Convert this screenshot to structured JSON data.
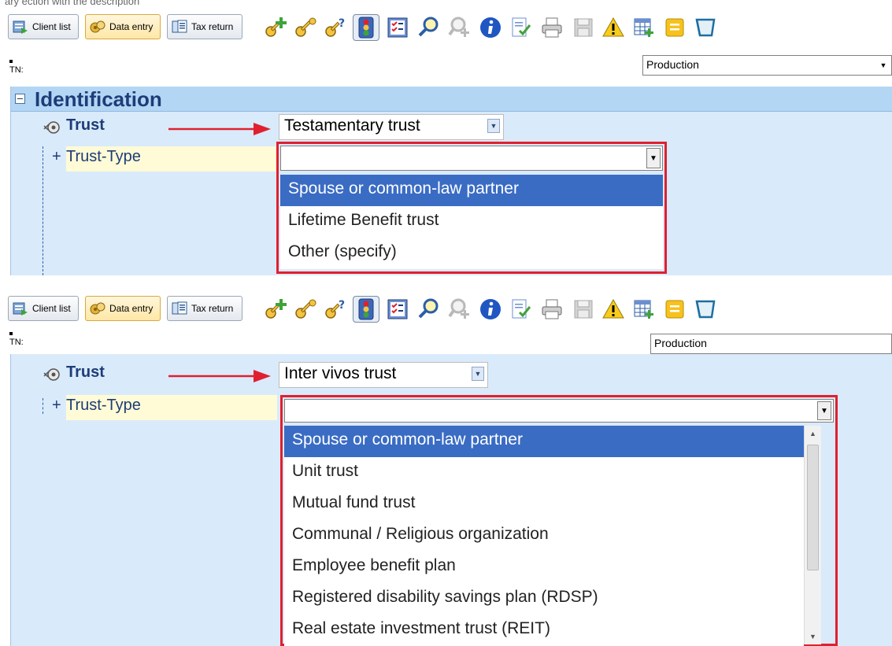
{
  "top_panel": {
    "top_cut_text": "ary                        ection  with  the  description",
    "toolbar": {
      "tabs": [
        {
          "name": "client-list-tab",
          "label": "Client list",
          "icon": "client-list-icon"
        },
        {
          "name": "data-entry-tab",
          "label": "Data entry",
          "icon": "data-entry-icon"
        },
        {
          "name": "tax-return-tab",
          "label": "Tax return",
          "icon": "tax-return-icon"
        }
      ]
    },
    "tn_label": "TN:",
    "production_value": "Production",
    "section_title": "Identification",
    "trust_label": "Trust",
    "trust_value": "Testamentary trust",
    "trust_type_label": "Trust-Type",
    "plus_glyph": "+",
    "combo_value": "",
    "options": [
      "Spouse or common-law partner",
      "Lifetime Benefit trust",
      "Other (specify)"
    ]
  },
  "bottom_panel": {
    "toolbar": {
      "tabs": [
        {
          "name": "client-list-tab",
          "label": "Client list",
          "icon": "client-list-icon"
        },
        {
          "name": "data-entry-tab",
          "label": "Data entry",
          "icon": "data-entry-icon"
        },
        {
          "name": "tax-return-tab",
          "label": "Tax return",
          "icon": "tax-return-icon"
        }
      ]
    },
    "tn_label": "TN:",
    "production_value": "Production",
    "trust_label": "Trust",
    "trust_value": "Inter vivos trust",
    "trust_type_label": "Trust-Type",
    "plus_glyph": "+",
    "combo_value": "",
    "options": [
      "Spouse or common-law partner",
      "Unit trust",
      "Mutual fund trust",
      "Communal / Religious organization",
      "Employee benefit plan",
      "Registered disability savings plan (RDSP)",
      "Real estate investment trust (REIT)"
    ]
  },
  "toolbar_icons": [
    "add-key-icon",
    "key-icon",
    "key-question-icon",
    "traffic-light-icon",
    "checklist-icon",
    "magnifier-icon",
    "magnifier-add-icon",
    "info-icon",
    "document-check-icon",
    "printer-icon",
    "save-icon",
    "warning-icon",
    "add-table-icon",
    "note-icon",
    "return-icon"
  ],
  "colors": {
    "highlight_red": "#e0202f",
    "selected_option": "#3a6cc4",
    "form_background": "#d9eafb",
    "section_header": "#b4d6f5",
    "label_blue": "#1d3d78",
    "label_highlight": "#fffbd6"
  }
}
